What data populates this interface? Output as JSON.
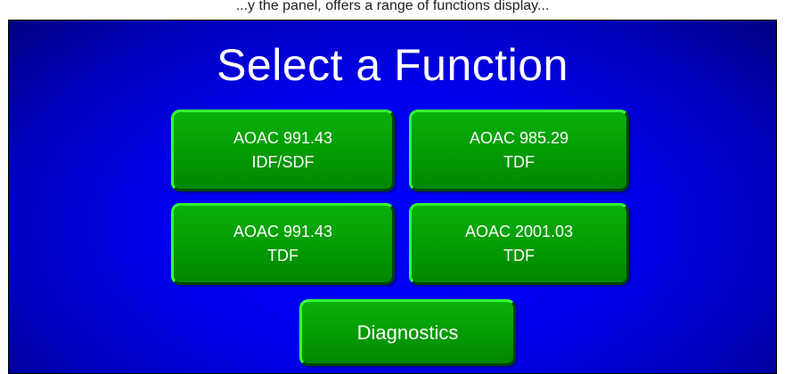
{
  "caption": "...y the panel, offers a range of functions display...",
  "screen": {
    "title": "Select a Function"
  },
  "buttons": [
    {
      "line1": "AOAC 991.43",
      "line2": "IDF/SDF"
    },
    {
      "line1": "AOAC 985.29",
      "line2": "TDF"
    },
    {
      "line1": "AOAC 991.43",
      "line2": "TDF"
    },
    {
      "line1": "AOAC 2001.03",
      "line2": "TDF"
    },
    {
      "line1": "Diagnostics"
    }
  ],
  "colors": {
    "background": "#0000ff",
    "button_fill": "#009900",
    "button_highlight": "#33ff33",
    "text": "#ffffff"
  }
}
